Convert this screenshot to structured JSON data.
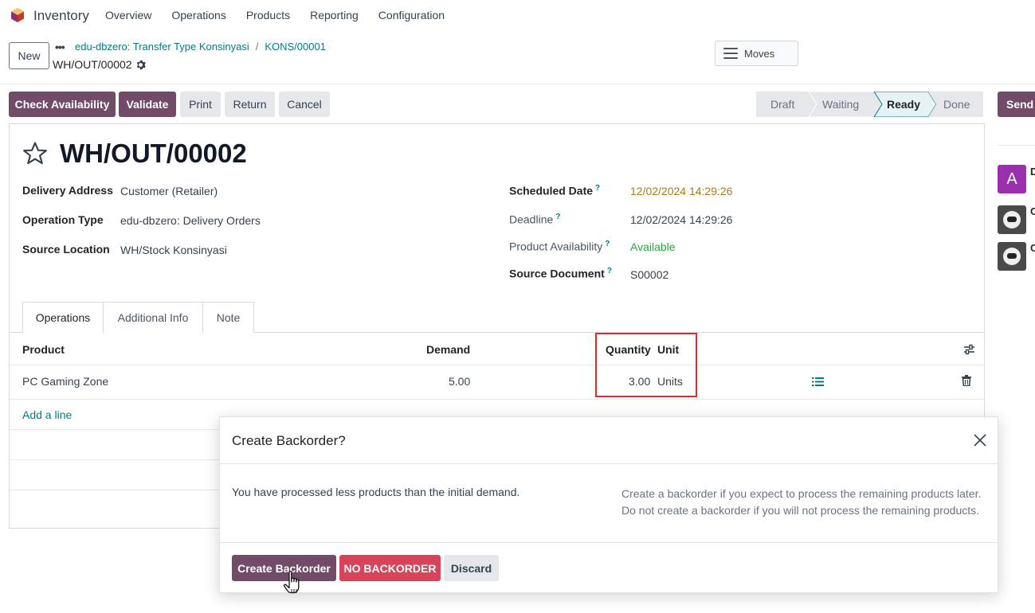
{
  "navbar": {
    "app_name": "Inventory",
    "menu": [
      "Overview",
      "Operations",
      "Products",
      "Reporting",
      "Configuration"
    ]
  },
  "control_panel": {
    "new_label": "New",
    "more_label": "•••",
    "breadcrumbs": [
      "edu-dbzero: Transfer Type Konsinyasi",
      "KONS/00001"
    ],
    "breadcrumb_sep": "/",
    "record_name": "WH/OUT/00002",
    "moves_label": "Moves"
  },
  "statusbar": {
    "buttons": [
      "Check Availability",
      "Validate",
      "Print",
      "Return",
      "Cancel"
    ],
    "stages": [
      "Draft",
      "Waiting",
      "Ready",
      "Done"
    ],
    "active_stage": "Ready",
    "send_label": "Send"
  },
  "form": {
    "title": "WH/OUT/00002",
    "left_fields": [
      {
        "label": "Delivery Address",
        "value": "Customer (Retailer)"
      },
      {
        "label": "Operation Type",
        "value": "edu-dbzero: Delivery Orders"
      },
      {
        "label": "Source Location",
        "value": "WH/Stock Konsinyasi"
      }
    ],
    "right_fields": [
      {
        "label": "Scheduled Date",
        "value": "12/02/2024 14:29:26",
        "value_color": "#a77b1b"
      },
      {
        "label": "Deadline",
        "value": "12/02/2024 14:29:26"
      },
      {
        "label": "Product Availability",
        "value": "Available",
        "value_color": "#28a745"
      },
      {
        "label": "Source Document",
        "value": "S00002"
      }
    ],
    "tooltip_mark": "?"
  },
  "tabs": [
    "Operations",
    "Additional Info",
    "Note"
  ],
  "table": {
    "headers": {
      "product": "Product",
      "demand": "Demand",
      "quantity": "Quantity",
      "unit": "Unit"
    },
    "rows": [
      {
        "product": "PC Gaming Zone",
        "demand": "5.00",
        "quantity": "3.00",
        "unit": "Units"
      }
    ],
    "add_line": "Add a line"
  },
  "chatter": {
    "avatar_letter": "A",
    "side_letters": [
      "D",
      "C",
      "C"
    ]
  },
  "modal": {
    "title": "Create Backorder?",
    "message": "You have processed less products than the initial demand.",
    "note_line1": "Create a backorder if you expect to process the remaining products later.",
    "note_line2": "Do not create a backorder if you will not process the remaining products.",
    "btn_create": "Create Backorder",
    "btn_no": "NO BACKORDER",
    "btn_discard": "Discard"
  },
  "colors": {
    "primary": "#714b67",
    "link": "#017e84",
    "danger": "#d9435a",
    "highlight_box": "#d32f2f"
  }
}
